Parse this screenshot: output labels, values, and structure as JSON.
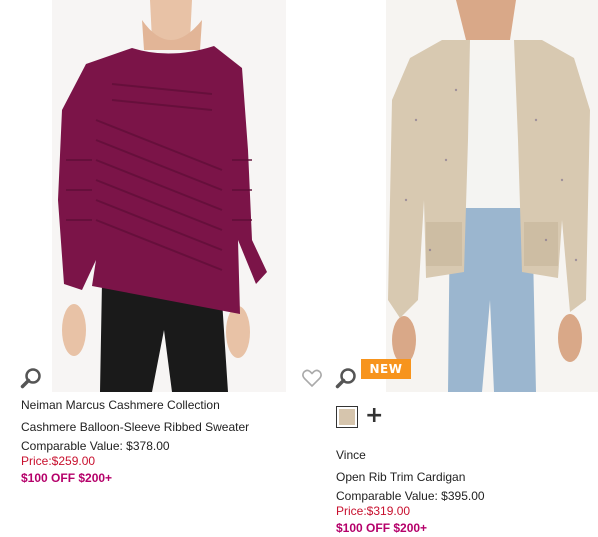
{
  "products": [
    {
      "designer": "Neiman Marcus Cashmere Collection",
      "name": "Cashmere Balloon-Sleeve Ribbed Sweater",
      "comparable": "Comparable Value: $378.00",
      "price": "Price:$259.00",
      "promo": "$100 OFF $200+",
      "image_alt": "Plum ribbed cashmere sweater with balloon sleeves"
    },
    {
      "badge": "NEW",
      "designer": "Vince",
      "name": "Open Rib Trim Cardigan",
      "comparable": "Comparable Value: $395.00",
      "price": "Price:$319.00",
      "promo": "$100 OFF $200+",
      "swatch_color": "#d6c5ad",
      "more_colors_symbol": "+",
      "image_alt": "Oatmeal flecked open-front cardigan with pockets"
    }
  ],
  "icons": {
    "quickview": "magnifier-icon",
    "favorite": "heart-outline-icon"
  },
  "colors": {
    "price": "#c8102e",
    "promo": "#b5006a",
    "badge": "#f7941d"
  }
}
